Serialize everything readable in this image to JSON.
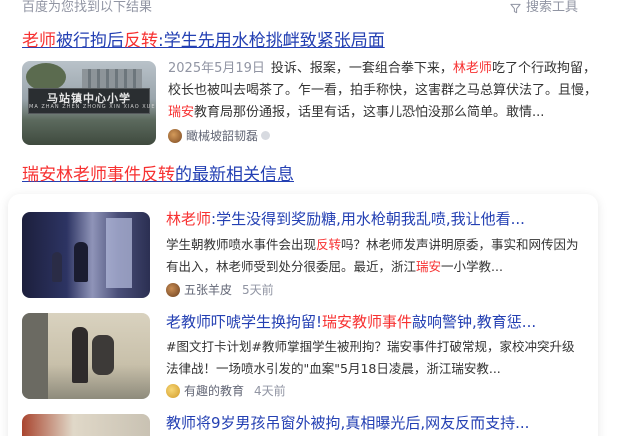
{
  "header": {
    "found_text": "百度为您找到以下结果",
    "tools_label": "搜索工具",
    "tools_icon": "filter-icon"
  },
  "result1": {
    "title_parts": {
      "p1": "老师",
      "p2": "被行拘后",
      "p3": "反转",
      "p4": ":学生先用水枪挑衅致紧张局面"
    },
    "thumb_sign_cn": "马站镇中心小学",
    "thumb_sign_py": "MA ZHAN ZHEN ZHONG XIN XIAO XUE",
    "date": "2025年5月19日",
    "abstract_parts": {
      "a1": "投诉、报案，一套组合拳下来，",
      "a2": "林老师",
      "a3": "吃了个行政拘留，校长也被叫去喝茶了。乍一看，拍手称快，这害群之马总算伏法了。且慢，",
      "a4": "瑞安",
      "a5": "教育局那份通报，话里有话，这事儿恐怕没那么简单。敢情..."
    },
    "source": "瞰械坡韶韧磊"
  },
  "related": {
    "title_parts": {
      "p1": "瑞安林老师事件反转",
      "p2": "的最新相关信息"
    },
    "items": [
      {
        "title_parts": {
          "p1": "林老师",
          "p2": ":学生没得到奖励糖,用水枪朝我乱喷,我让他看..."
        },
        "text_parts": {
          "t1": "学生朝教师喷水事件会出现",
          "t2": "反转",
          "t3": "吗？林老师发声讲明原委，事实和网传因为有出入，林老师受到处分很委屈。最近，浙江",
          "t4": "瑞安",
          "t5": "一小学教..."
        },
        "source": "五张羊皮",
        "time": "5天前"
      },
      {
        "title_parts": {
          "p1": "老教师吓唬学生换拘留!",
          "p2": "瑞安教师事件",
          "p3": "敲响警钟,教育惩..."
        },
        "text_parts": {
          "t1": "#图文打卡计划#教师掌掴学生被刑拘？瑞安事件打破常规，家校冲突升级法律战！一场喷水引发的\"血案\"5月18日凌晨，浙江瑞安教..."
        },
        "source": "有趣的教育",
        "time": "4天前"
      },
      {
        "title_parts": {
          "p1": "教师将9岁男孩吊窗外被拘,真相曝光后,网友反而支持..."
        }
      }
    ]
  },
  "colors": {
    "link": "#2440b3",
    "highlight": "#f73131",
    "muted": "#9195a3"
  }
}
